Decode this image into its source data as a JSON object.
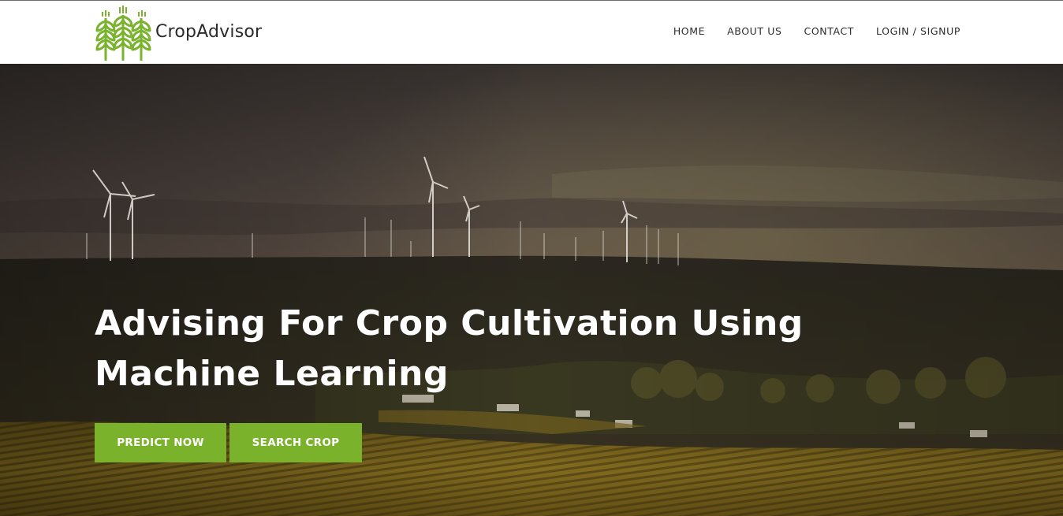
{
  "header": {
    "brand_name": "CropAdvisor",
    "nav": {
      "home": "HOME",
      "about": "ABOUT US",
      "contact": "CONTACT",
      "login": "LOGIN / SIGNUP"
    }
  },
  "hero": {
    "headline_line1": "Advising For Crop Cultivation Using",
    "headline_line2": "Machine Learning",
    "buttons": {
      "predict": "PREDICT NOW",
      "search": "SEARCH CROP"
    }
  },
  "colors": {
    "accent": "#7bb22b",
    "logo_green": "#7ab32e",
    "header_bg": "#ffffff",
    "nav_text": "#2d2d2d"
  },
  "icons": {
    "logo": "wheat-stalks-icon"
  }
}
